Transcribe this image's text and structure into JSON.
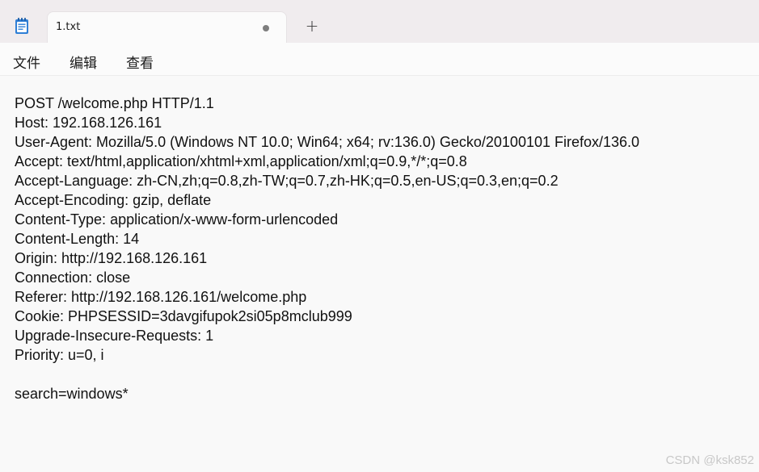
{
  "tab": {
    "title": "1.txt"
  },
  "new_tab_symbol": "+",
  "menu": [
    {
      "label": "文件"
    },
    {
      "label": "编辑"
    },
    {
      "label": "查看"
    }
  ],
  "lines": [
    "POST /welcome.php HTTP/1.1",
    "Host: 192.168.126.161",
    "User-Agent: Mozilla/5.0 (Windows NT 10.0; Win64; x64; rv:136.0) Gecko/20100101 Firefox/136.0",
    "Accept: text/html,application/xhtml+xml,application/xml;q=0.9,*/*;q=0.8",
    "Accept-Language: zh-CN,zh;q=0.8,zh-TW;q=0.7,zh-HK;q=0.5,en-US;q=0.3,en;q=0.2",
    "Accept-Encoding: gzip, deflate",
    "Content-Type: application/x-www-form-urlencoded",
    "Content-Length: 14",
    "Origin: http://192.168.126.161",
    "Connection: close",
    "Referer: http://192.168.126.161/welcome.php",
    "Cookie: PHPSESSID=3davgifupok2si05p8mclub999",
    "Upgrade-Insecure-Requests: 1",
    "Priority: u=0, i",
    "",
    "search=windows*"
  ],
  "watermark": "CSDN @ksk852",
  "icons": {
    "app": "notepad-icon",
    "unsaved": "unsaved-dot-icon"
  },
  "colors": {
    "titlebar": "#f0ecee",
    "tab": "#fbfbfb",
    "editor": "#f9f9f9",
    "icon_blue": "#2f7fd6"
  }
}
